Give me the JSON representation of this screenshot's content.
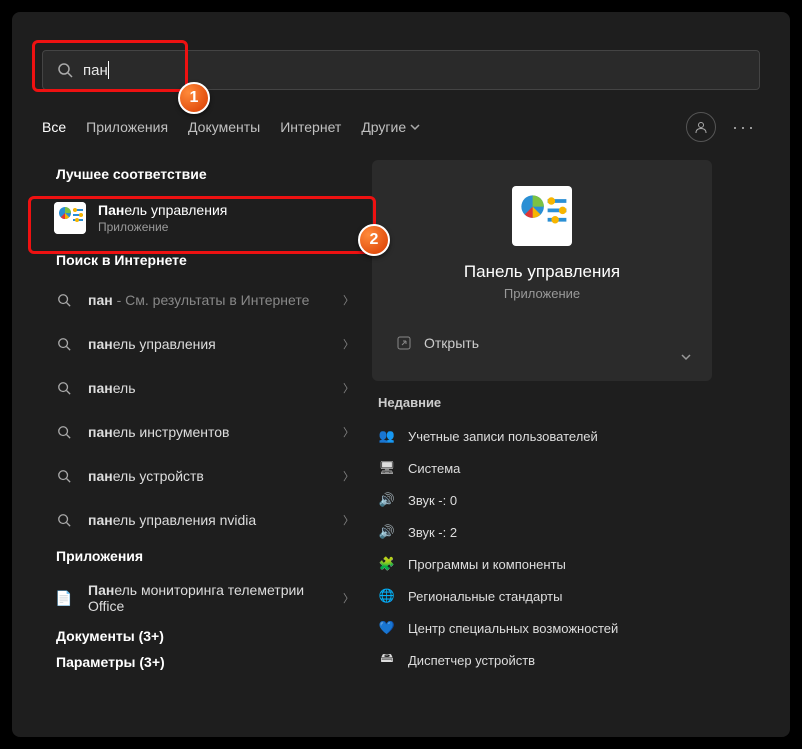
{
  "search": {
    "value": "пан"
  },
  "tabs": {
    "all": "Все",
    "apps": "Приложения",
    "docs": "Документы",
    "web": "Интернет",
    "more": "Другие"
  },
  "sections": {
    "best": "Лучшее соответствие",
    "web": "Поиск в Интернете",
    "apps": "Приложения",
    "docs_more": "Документы (3+)",
    "params_more": "Параметры (3+)"
  },
  "bestMatch": {
    "bold": "Пан",
    "rest": "ель управления",
    "sub": "Приложение"
  },
  "webResults": [
    {
      "bold": "пан",
      "rest": "",
      "suffix": " - См. результаты в Интернете"
    },
    {
      "bold": "пан",
      "rest": "ель управления",
      "suffix": ""
    },
    {
      "bold": "пан",
      "rest": "ель",
      "suffix": ""
    },
    {
      "bold": "пан",
      "rest": "ель инструментов",
      "suffix": ""
    },
    {
      "bold": "пан",
      "rest": "ель устройств",
      "suffix": ""
    },
    {
      "bold": "пан",
      "rest": "ель управления nvidia",
      "suffix": ""
    }
  ],
  "appsResults": [
    {
      "bold": "Пан",
      "rest": "ель мониторинга телеметрии Office"
    }
  ],
  "preview": {
    "title": "Панель управления",
    "sub": "Приложение",
    "open": "Открыть",
    "recent": "Недавние"
  },
  "recent": [
    {
      "icon": "👥",
      "label": "Учетные записи пользователей"
    },
    {
      "icon": "🖥",
      "label": "Система"
    },
    {
      "icon": "🔊",
      "label": "Звук -: 0"
    },
    {
      "icon": "🔊",
      "label": "Звук -: 2"
    },
    {
      "icon": "🧩",
      "label": "Программы и компоненты"
    },
    {
      "icon": "🌐",
      "label": "Региональные стандарты"
    },
    {
      "icon": "💙",
      "label": "Центр специальных возможностей"
    },
    {
      "icon": "🖴",
      "label": "Диспетчер устройств"
    }
  ],
  "annotations": {
    "n1": "1",
    "n2": "2"
  }
}
